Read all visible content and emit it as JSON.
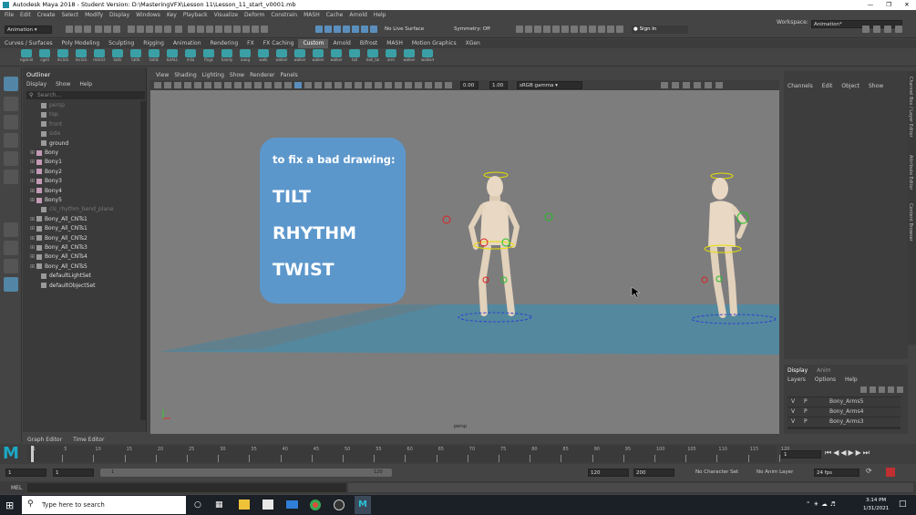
{
  "window": {
    "title": "Autodesk Maya 2018 - Student Version: D:\\MasteringVFX\\Lesson 11\\Lesson_11_start_v0001.mb"
  },
  "menus": [
    "File",
    "Edit",
    "Create",
    "Select",
    "Modify",
    "Display",
    "Windows",
    "Key",
    "Playback",
    "Visualize",
    "Deform",
    "Constrain",
    "MASH",
    "Cache",
    "Arnold",
    "Help"
  ],
  "workspace": {
    "label": "Workspace:",
    "value": "Animation*"
  },
  "status": {
    "mode": "Animation",
    "live": "No Live Surface",
    "symmetry": "Symmetry: Off",
    "signin": "Sign In"
  },
  "shelf_tabs": [
    "Curves / Surfaces",
    "Poly Modeling",
    "Sculpting",
    "Rigging",
    "Animation",
    "Rendering",
    "FX",
    "FX Caching",
    "Custom",
    "Arnold",
    "Bifrost",
    "MASH",
    "Motion Graphics",
    "XGen"
  ],
  "shelf_active": "Custom",
  "shelf_items": [
    "ngskint",
    "cgell",
    "mclick",
    "mclick",
    "mdclct",
    "tatik",
    "tattk",
    "tatlik",
    "tatALL",
    "mlia",
    "flngs",
    "handy",
    "aang",
    "walk",
    "walker",
    "walker",
    "walker",
    "walker",
    "tail",
    "ball_tai",
    "arm",
    "walker",
    "walkert"
  ],
  "outliner": {
    "title": "Outliner",
    "menu": [
      "Display",
      "Show",
      "Help"
    ],
    "search_placeholder": "Search...",
    "items": [
      "persp",
      "top",
      "front",
      "side",
      "ground",
      "Bony",
      "Bony1",
      "Bony2",
      "Bony3",
      "Bony4",
      "Bony5",
      "cls_rhythm_bend_plane",
      "Bony_All_CNTs1",
      "Bony_All_CNTs1",
      "Bony_All_CNTs2",
      "Bony_All_CNTs3",
      "Bony_All_CNTs4",
      "Bony_All_CNTs5",
      "defaultLightSet",
      "defaultObjectSet"
    ]
  },
  "viewport": {
    "menu": [
      "View",
      "Shading",
      "Lighting",
      "Show",
      "Renderer",
      "Panels"
    ],
    "exposure": "0.00",
    "gamma": "1.00",
    "colorspace": "sRGB gamma",
    "camera": "persp"
  },
  "card": {
    "heading": "to fix a bad drawing:",
    "lines": [
      "TILT",
      "RHYTHM",
      "TWIST"
    ]
  },
  "channel_box": {
    "menu": [
      "Channels",
      "Edit",
      "Object",
      "Show"
    ]
  },
  "side_tabs": [
    "Channel Box / Layer Editor",
    "Attribute Editor",
    "Content Browser"
  ],
  "layer_editor": {
    "tabs": [
      "Display",
      "Anim"
    ],
    "menu": [
      "Layers",
      "Options",
      "Help"
    ],
    "layers": [
      {
        "v": "V",
        "p": "P",
        "name": "Bony_Arms5"
      },
      {
        "v": "V",
        "p": "P",
        "name": "Bony_Arms4"
      },
      {
        "v": "V",
        "p": "P",
        "name": "Bony_Arms3"
      }
    ]
  },
  "editors": [
    "Graph Editor",
    "Time Editor"
  ],
  "timeline": {
    "ticks": [
      "1",
      "5",
      "10",
      "15",
      "20",
      "25",
      "30",
      "35",
      "40",
      "45",
      "50",
      "55",
      "60",
      "65",
      "70",
      "75",
      "80",
      "85",
      "90",
      "95",
      "100",
      "105",
      "110",
      "115",
      "120"
    ],
    "current": "1"
  },
  "range": {
    "start": "1",
    "start2": "1",
    "rs": "1",
    "re": "120",
    "end": "120",
    "end2": "200",
    "charset": "No Character Set",
    "animlayer": "No Anim Layer",
    "fps": "24 fps"
  },
  "mel": {
    "label": "MEL"
  },
  "taskbar": {
    "search": "Type here to search",
    "time": "3:14 PM",
    "date": "1/31/2021"
  }
}
